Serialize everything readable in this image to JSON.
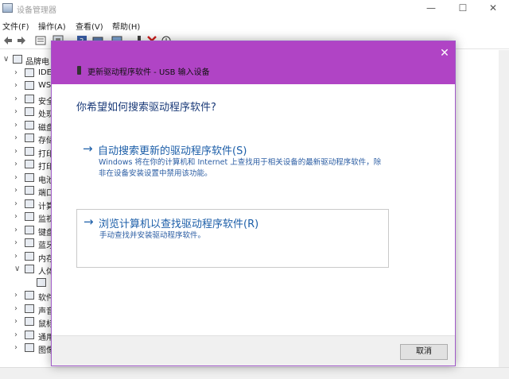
{
  "window": {
    "title": "设备管理器",
    "controls": {
      "minimize": "—",
      "maximize": "☐",
      "close": "✕"
    }
  },
  "menu": [
    "文件(F)",
    "操作(A)",
    "查看(V)",
    "帮助(H)"
  ],
  "toolbar_icons": [
    "back-icon",
    "forward-icon",
    "properties-icon",
    "update-driver-icon",
    "scan-icon",
    "monitor-icon",
    "plug-icon",
    "uninstall-icon",
    "download-icon"
  ],
  "tree": {
    "root": "品牌电",
    "items": [
      {
        "label": "IDE",
        "expanded": false
      },
      {
        "label": "WS",
        "expanded": false
      },
      {
        "label": "安全",
        "expanded": false
      },
      {
        "label": "处现",
        "expanded": false
      },
      {
        "label": "磁盘",
        "expanded": false
      },
      {
        "label": "存储",
        "expanded": false
      },
      {
        "label": "打印",
        "expanded": false
      },
      {
        "label": "打印",
        "expanded": false
      },
      {
        "label": "电池",
        "expanded": false
      },
      {
        "label": "端口",
        "expanded": false
      },
      {
        "label": "计算",
        "expanded": false
      },
      {
        "label": "监视",
        "expanded": false
      },
      {
        "label": "键盘",
        "expanded": false
      },
      {
        "label": "蓝牙",
        "expanded": false
      },
      {
        "label": "内存",
        "expanded": false
      },
      {
        "label": "人体",
        "expanded": true
      },
      {
        "label": "",
        "expanded": null
      },
      {
        "label": "软件",
        "expanded": false
      },
      {
        "label": "声音",
        "expanded": false
      },
      {
        "label": "鼠标",
        "expanded": false
      },
      {
        "label": "通用",
        "expanded": false
      },
      {
        "label": "图像",
        "expanded": false
      }
    ]
  },
  "dialog": {
    "close": "✕",
    "header": "更新驱动程序软件 - USB 输入设备",
    "question": "你希望如何搜索驱动程序软件?",
    "options": {
      "auto": {
        "arrow": "→",
        "title": "自动搜索更新的驱动程序软件(S)",
        "desc": "Windows 将在你的计算机和 Internet 上查找用于相关设备的最新驱动程序软件，除非在设备安装设置中禁用该功能。"
      },
      "browse": {
        "arrow": "→",
        "title": "浏览计算机以查找驱动程序软件(R)",
        "desc": "手动查找并安装驱动程序软件。"
      }
    },
    "cancel_label": "取消"
  },
  "colors": {
    "dialog_titlebar": "#b044c5",
    "link_blue": "#1c5ea8",
    "question_blue": "#1a3a78"
  }
}
